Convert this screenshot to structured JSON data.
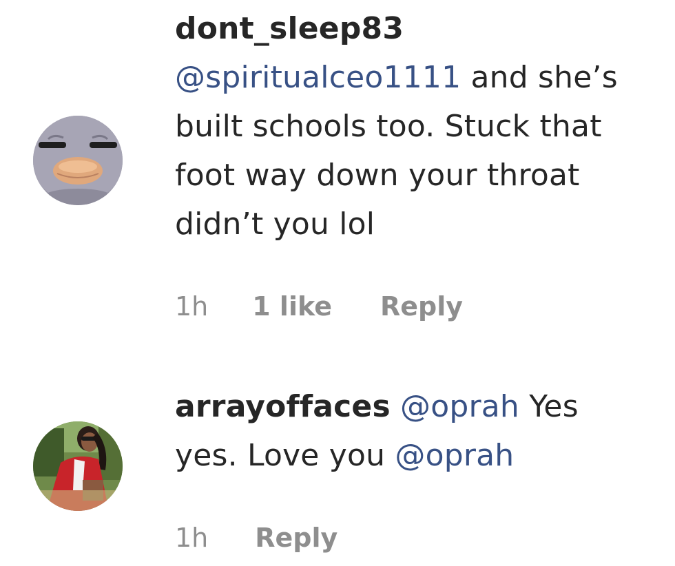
{
  "comments": [
    {
      "username": "dont_sleep83",
      "mention": "@spiritualceo1111",
      "text": " and she’s built schools too. Stuck that foot way down your throat didn’t you lol",
      "time": "1h",
      "likes": "1 like",
      "reply": "Reply"
    },
    {
      "username": "arrayoffaces",
      "mention1": "@oprah",
      "text1": " Yes yes. Love you ",
      "mention2": "@oprah",
      "time": "1h",
      "reply": "Reply"
    }
  ],
  "colors": {
    "text": "#262626",
    "mention": "#385185",
    "meta": "#8e8e8e"
  }
}
